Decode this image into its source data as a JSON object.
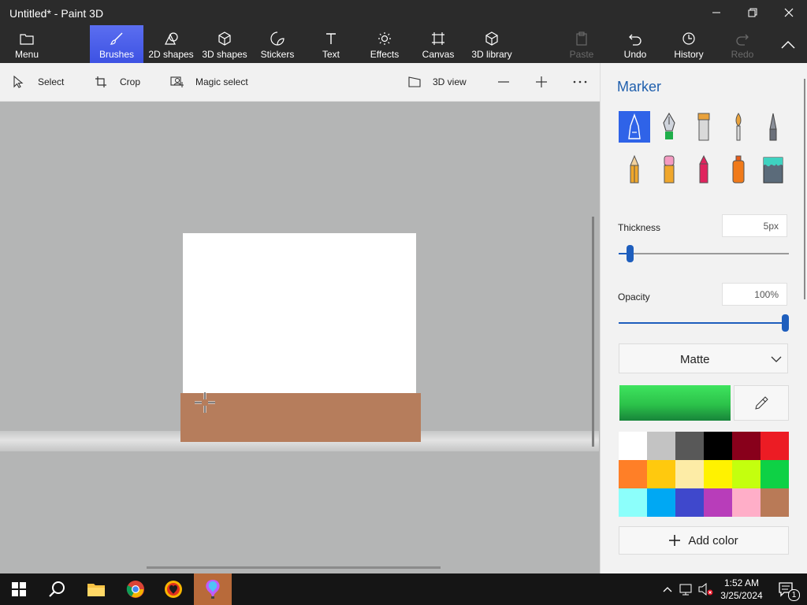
{
  "window": {
    "title": "Untitled* - Paint 3D"
  },
  "ribbon": {
    "menu": "Menu",
    "brushes": "Brushes",
    "shapes2d": "2D shapes",
    "shapes3d": "3D shapes",
    "stickers": "Stickers",
    "text": "Text",
    "effects": "Effects",
    "canvas": "Canvas",
    "library3d": "3D library",
    "paste": "Paste",
    "undo": "Undo",
    "history": "History",
    "redo": "Redo"
  },
  "toolbar": {
    "select": "Select",
    "crop": "Crop",
    "magic_select": "Magic select",
    "view3d": "3D view"
  },
  "panel": {
    "title": "Marker",
    "brushes": [
      "marker",
      "calligraphy-pen",
      "oil-brush",
      "watercolor",
      "pixel-pen",
      "pencil",
      "eraser",
      "crayon",
      "spray-can",
      "fill"
    ],
    "thickness_label": "Thickness",
    "thickness_value": "5px",
    "thickness_level": 0.05,
    "opacity_label": "Opacity",
    "opacity_value": "100%",
    "opacity_level": 1.0,
    "finish": "Matte",
    "current_color": "#2fcf4d",
    "palette": [
      "#ffffff",
      "#c3c3c3",
      "#585858",
      "#000000",
      "#88001b",
      "#ec1c24",
      "#ff7f27",
      "#ffc90e",
      "#fdeca6",
      "#fff200",
      "#c4ff0e",
      "#0ed145",
      "#8cfffb",
      "#00a8f3",
      "#3f48cc",
      "#b83dba",
      "#ffaec8",
      "#b97a57"
    ],
    "add_color": "Add color"
  },
  "colors": {
    "accent": "#3d52e3",
    "paint_brown": "#b67d5c"
  },
  "taskbar": {
    "time": "1:52 AM",
    "date": "3/25/2024",
    "notifications": "1"
  }
}
